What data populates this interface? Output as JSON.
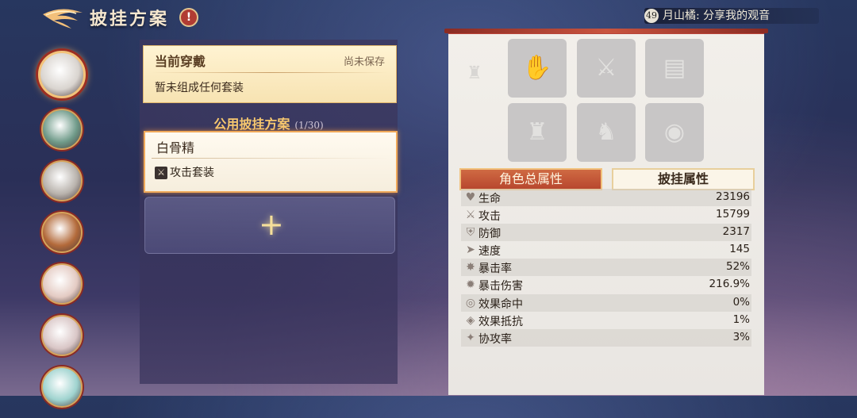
{
  "header": {
    "title": "披挂方案",
    "help_icon": "!",
    "broadcast": {
      "level": "49",
      "text": "月山橘: 分享我的观音"
    }
  },
  "heroes": [
    {
      "name": "hero-1",
      "color": "#d9d4cf",
      "selected": true
    },
    {
      "name": "hero-2",
      "color": "#6f9a89"
    },
    {
      "name": "hero-3",
      "color": "#b9b3ad"
    },
    {
      "name": "hero-4",
      "color": "#b36a3a"
    },
    {
      "name": "hero-5",
      "color": "#e4cbc3"
    },
    {
      "name": "hero-6",
      "color": "#d9c6c6"
    },
    {
      "name": "hero-7",
      "color": "#9fd3cf"
    }
  ],
  "current": {
    "title": "当前穿戴",
    "status": "尚未保存",
    "description": "暂未组成任何套装"
  },
  "plans": {
    "heading": "公用披挂方案",
    "count": "(1/30)",
    "items": [
      {
        "name": "白骨精",
        "tag": "攻击套装"
      }
    ],
    "add_label": "+"
  },
  "equipment": [
    {
      "icon": "armguard-icon",
      "glyph": "✋"
    },
    {
      "icon": "sword-icon",
      "glyph": "⚔"
    },
    {
      "icon": "book-icon",
      "glyph": "▤"
    },
    {
      "icon": "armor-icon",
      "glyph": "♜"
    },
    {
      "icon": "boots-icon",
      "glyph": "♞"
    },
    {
      "icon": "orb-icon",
      "glyph": "◉"
    }
  ],
  "tabs": {
    "total": "角色总属性",
    "gear": "披挂属性"
  },
  "stats": [
    {
      "icon": "heart-icon",
      "glyph": "♥",
      "label": "生命",
      "value": "23196"
    },
    {
      "icon": "sword-icon",
      "glyph": "⚔",
      "label": "攻击",
      "value": "15799"
    },
    {
      "icon": "shield-icon",
      "glyph": "⛨",
      "label": "防御",
      "value": "2317"
    },
    {
      "icon": "speed-icon",
      "glyph": "➤",
      "label": "速度",
      "value": "145"
    },
    {
      "icon": "crit-icon",
      "glyph": "✸",
      "label": "暴击率",
      "value": "52%"
    },
    {
      "icon": "crit-damage-icon",
      "glyph": "✹",
      "label": "暴击伤害",
      "value": "216.9%"
    },
    {
      "icon": "effect-hit-icon",
      "glyph": "◎",
      "label": "效果命中",
      "value": "0%"
    },
    {
      "icon": "effect-resist-icon",
      "glyph": "◈",
      "label": "效果抵抗",
      "value": "1%"
    },
    {
      "icon": "co-attack-icon",
      "glyph": "✦",
      "label": "协攻率",
      "value": "3%"
    }
  ]
}
